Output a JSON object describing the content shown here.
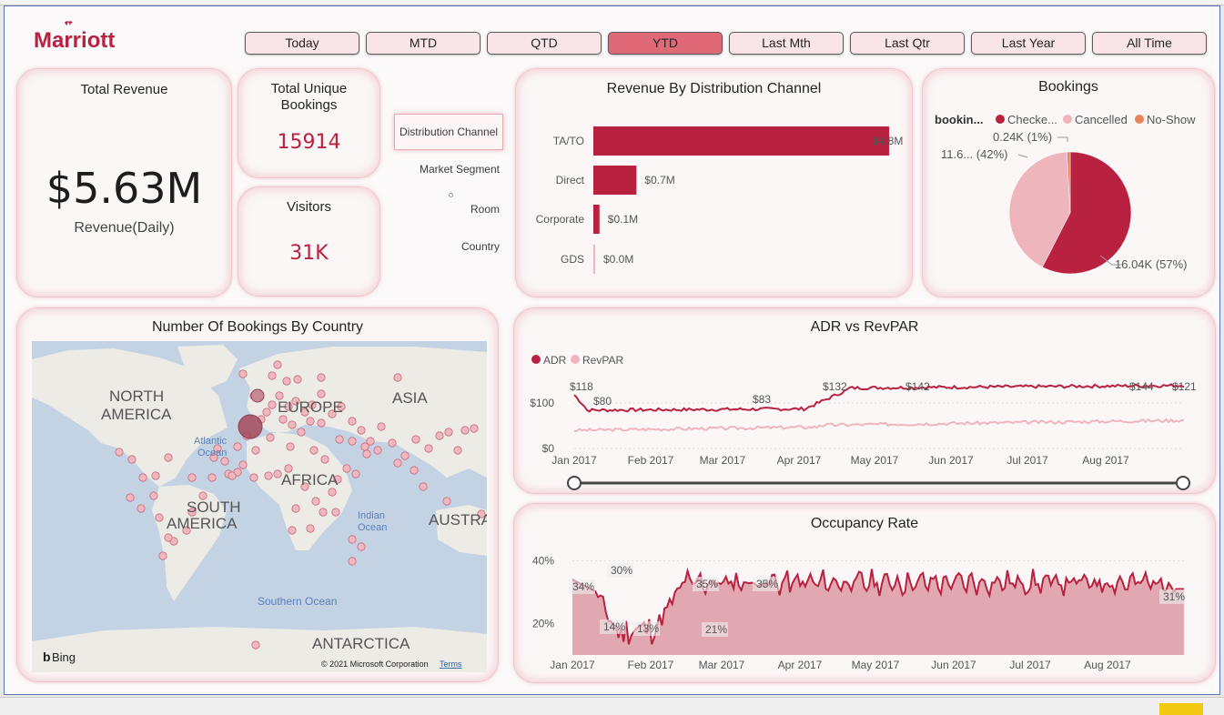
{
  "brand": {
    "logo": "Marriott",
    "color": "#b8213f"
  },
  "time_filters": [
    {
      "label": "Today",
      "active": false
    },
    {
      "label": "MTD",
      "active": false
    },
    {
      "label": "QTD",
      "active": false
    },
    {
      "label": "YTD",
      "active": true
    },
    {
      "label": "Last Mth",
      "active": false
    },
    {
      "label": "Last Qtr",
      "active": false
    },
    {
      "label": "Last Year",
      "active": false
    },
    {
      "label": "All Time",
      "active": false
    }
  ],
  "total_revenue": {
    "title": "Total Revenue",
    "value": "$5.63M",
    "caption": "Revenue(Daily)"
  },
  "unique_bookings": {
    "title": "Total Unique Bookings",
    "value": "15914"
  },
  "visitors": {
    "title": "Visitors",
    "value": "31K"
  },
  "slicer": {
    "items": [
      {
        "label": "Distribution Channel",
        "selected": true
      },
      {
        "label": "Market Segment",
        "selected": false
      },
      {
        "label": "Room",
        "selected": false
      },
      {
        "label": "Country",
        "selected": false
      }
    ]
  },
  "colors": {
    "primary": "#b8213f",
    "light": "#efb5bc",
    "orange": "#e8845a"
  },
  "chart_data": [
    {
      "type": "bar",
      "title": "Revenue By Distribution Channel",
      "orientation": "horizontal",
      "categories": [
        "TA/TO",
        "Direct",
        "Corporate",
        "GDS"
      ],
      "values": [
        4.8,
        0.7,
        0.1,
        0.0
      ],
      "data_labels": [
        "$4.8M",
        "$0.7M",
        "$0.1M",
        "$0.0M"
      ]
    },
    {
      "type": "pie",
      "title": "Bookings",
      "legend_title": "bookin...",
      "legend_position": "top",
      "categories": [
        "Checke...",
        "Cancelled",
        "No-Show"
      ],
      "values": [
        16.04,
        11.6,
        0.24
      ],
      "data_labels": [
        "16.04K (57%)",
        "11.6... (42%)",
        "0.24K (1%)"
      ]
    },
    {
      "type": "line",
      "title": "ADR vs RevPAR",
      "legend_position": "top-left",
      "series": [
        {
          "name": "ADR",
          "color": "#b8213f"
        },
        {
          "name": "RevPAR",
          "color": "#efb5bc"
        }
      ],
      "x_ticks": [
        "Jan 2017",
        "Feb 2017",
        "Mar 2017",
        "Apr 2017",
        "May 2017",
        "Jun 2017",
        "Jul 2017",
        "Aug 2017"
      ],
      "y_ticks": [
        "$0",
        "$100"
      ],
      "ylim": [
        0,
        140
      ],
      "annotations": [
        "$118",
        "$80",
        "$83",
        "$132",
        "$142",
        "$144",
        "$121"
      ]
    },
    {
      "type": "area",
      "title": "Occupancy Rate",
      "x_ticks": [
        "Jan 2017",
        "Feb 2017",
        "Mar 2017",
        "Apr 2017",
        "May 2017",
        "Jun 2017",
        "Jul 2017",
        "Aug 2017"
      ],
      "y_ticks": [
        "40%",
        "20%"
      ],
      "ylim": [
        10,
        43
      ],
      "annotations": [
        "34%",
        "30%",
        "14%",
        "13%",
        "21%",
        "35%",
        "35%",
        "31%"
      ]
    }
  ],
  "map": {
    "title": "Number Of Bookings By Country",
    "labels": {
      "north_america": [
        "NORTH",
        "AMERICA"
      ],
      "europe": "EUROPE",
      "asia": "ASIA",
      "africa": "AFRICA",
      "south_america": [
        "SOUTH",
        "AMERICA"
      ],
      "australia": "AUSTRA",
      "atlantic": [
        "Atlantic",
        "Ocean"
      ],
      "indian": [
        "Indian",
        "Ocean"
      ],
      "southern": "Southern Ocean",
      "antarctica": "ANTARCTICA"
    },
    "bing": "Bing",
    "copyright": "© 2021 Microsoft Corporation",
    "terms": "Terms"
  }
}
